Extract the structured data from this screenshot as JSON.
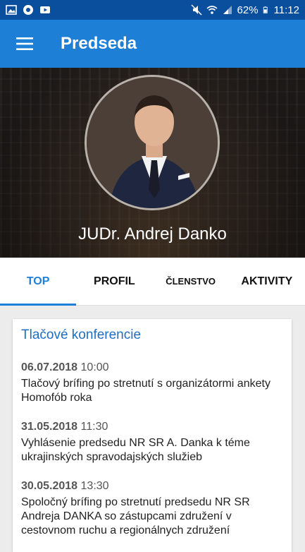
{
  "status_bar": {
    "battery": "62%",
    "time": "11:12"
  },
  "app_bar": {
    "title": "Predseda"
  },
  "hero": {
    "name": "JUDr. Andrej Danko"
  },
  "tabs": [
    {
      "label": "TOP",
      "active": true
    },
    {
      "label": "PROFIL",
      "active": false
    },
    {
      "label": "ČLENSTVO",
      "active": false
    },
    {
      "label": "AKTIVITY",
      "active": false
    }
  ],
  "card": {
    "title": "Tlačové konferencie",
    "items": [
      {
        "date": "06.07.2018",
        "time": "10:00",
        "text": "Tlačový brífing po stretnutí s organizátormi ankety Homofób roka"
      },
      {
        "date": "31.05.2018",
        "time": "11:30",
        "text": "Vyhlásenie predsedu NR SR A. Danka k téme ukrajinských spravodajských služieb"
      },
      {
        "date": "30.05.2018",
        "time": "13:30",
        "text": "Spoločný brífing po stretnutí predsedu NR SR Andreja DANKA so zástupcami združení v cestovnom ruchu a regionálnych združení"
      }
    ]
  },
  "colors": {
    "status_bar": "#0a4f9e",
    "app_bar": "#1e7fd6",
    "accent": "#1e7fd6"
  }
}
